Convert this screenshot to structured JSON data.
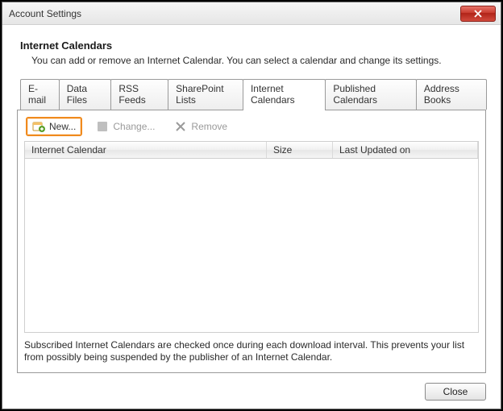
{
  "window": {
    "title": "Account Settings"
  },
  "header": {
    "title": "Internet Calendars",
    "subtitle": "You can add or remove an Internet Calendar. You can select a calendar and change its settings."
  },
  "tabs": [
    {
      "label": "E-mail"
    },
    {
      "label": "Data Files"
    },
    {
      "label": "RSS Feeds"
    },
    {
      "label": "SharePoint Lists"
    },
    {
      "label": "Internet Calendars"
    },
    {
      "label": "Published Calendars"
    },
    {
      "label": "Address Books"
    }
  ],
  "toolbar": {
    "new_label": "New...",
    "change_label": "Change...",
    "remove_label": "Remove"
  },
  "grid": {
    "columns": {
      "name": "Internet Calendar",
      "size": "Size",
      "updated": "Last Updated on"
    },
    "rows": []
  },
  "note": "Subscribed Internet Calendars are checked once during each download interval. This prevents your list from possibly being suspended by the publisher of an Internet Calendar.",
  "footer": {
    "close_label": "Close"
  }
}
